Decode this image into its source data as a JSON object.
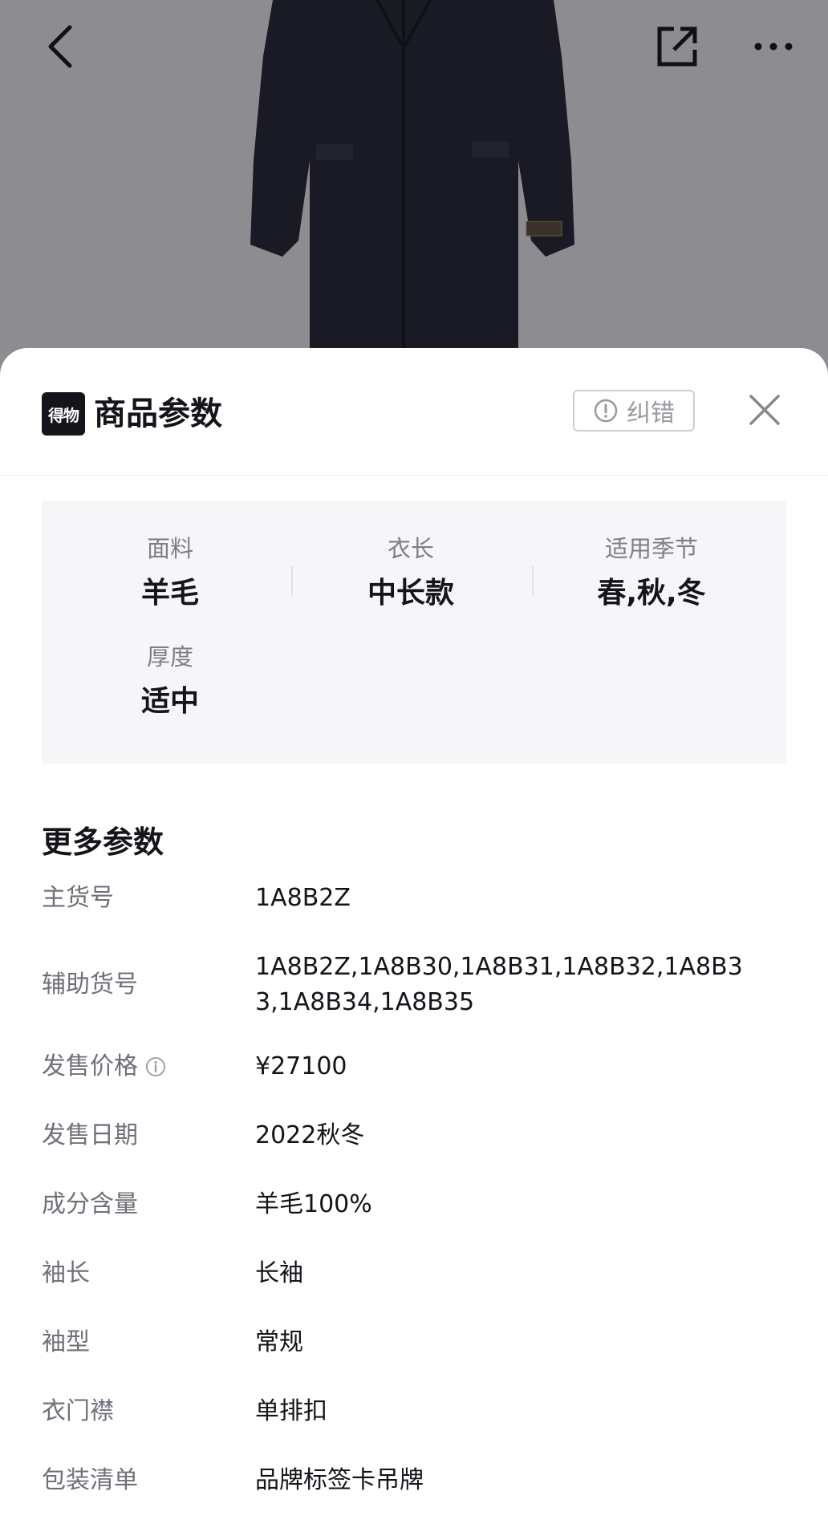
{
  "colors": {
    "accent": "#14151a",
    "muted": "#7d7e86",
    "card_bg": "#f6f6f8",
    "hero_bg": "#8d8d91"
  },
  "topbar": {
    "back_icon": "chevron-left-icon",
    "share_icon": "share-icon",
    "more_icon": "more-icon"
  },
  "sheet": {
    "logo_text": "得物",
    "title": "商品参数",
    "report_label": "纠错",
    "close_icon": "close-icon"
  },
  "summary": [
    {
      "label": "面料",
      "value": "羊毛"
    },
    {
      "label": "衣长",
      "value": "中长款"
    },
    {
      "label": "适用季节",
      "value": "春,秋,冬"
    },
    {
      "label": "厚度",
      "value": "适中"
    }
  ],
  "more": {
    "title": "更多参数",
    "params": [
      {
        "label": "主货号",
        "value": "1A8B2Z"
      },
      {
        "label": "辅助货号",
        "value": "1A8B2Z,1A8B30,1A8B31,1A8B32,1A8B33,1A8B34,1A8B35"
      },
      {
        "label": "发售价格",
        "value": "¥27100"
      },
      {
        "label": "发售日期",
        "value": "2022秋冬"
      },
      {
        "label": "成分含量",
        "value": "羊毛100%"
      },
      {
        "label": "袖长",
        "value": "长袖"
      },
      {
        "label": "袖型",
        "value": "常规"
      },
      {
        "label": "衣门襟",
        "value": "单排扣"
      },
      {
        "label": "包装清单",
        "value": "品牌标签卡吊牌"
      }
    ]
  }
}
